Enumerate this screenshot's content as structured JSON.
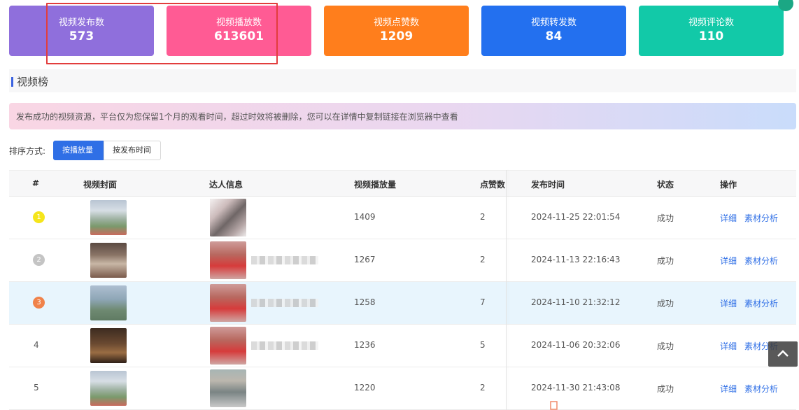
{
  "stats": [
    {
      "label": "视频发布数",
      "value": "573",
      "color": "#8f6fdc"
    },
    {
      "label": "视频播放数",
      "value": "613601",
      "color": "#ff5b94"
    },
    {
      "label": "视频点赞数",
      "value": "1209",
      "color": "#ff7e1c"
    },
    {
      "label": "视频转发数",
      "value": "84",
      "color": "#2370ef"
    },
    {
      "label": "视频评论数",
      "value": "110",
      "color": "#12c9a8"
    }
  ],
  "section": {
    "title": "视频榜"
  },
  "notice": {
    "text": "发布成功的视频资源，平台仅为您保留1个月的观看时间，超过时效将被删除，您可以在详情中复制链接在浏览器中查看"
  },
  "sort": {
    "label": "排序方式:",
    "options": [
      "按播放量",
      "按发布时间"
    ],
    "active": "按播放量"
  },
  "table": {
    "headers": [
      "#",
      "视频封面",
      "达人信息",
      "视频播放量",
      "点赞数",
      "发布时间",
      "状态",
      "操作"
    ],
    "rows": [
      {
        "rank": "1",
        "plays": "1409",
        "likes": "2",
        "time": "2024-11-25 22:01:54",
        "status": "成功",
        "actions": [
          "详细",
          "素材分析"
        ]
      },
      {
        "rank": "2",
        "plays": "1267",
        "likes": "2",
        "time": "2024-11-13 22:16:43",
        "status": "成功",
        "actions": [
          "详细",
          "素材分析"
        ]
      },
      {
        "rank": "3",
        "plays": "1258",
        "likes": "7",
        "time": "2024-11-10 21:32:12",
        "status": "成功",
        "actions": [
          "详细",
          "素材分析"
        ]
      },
      {
        "rank": "4",
        "plays": "1236",
        "likes": "5",
        "time": "2024-11-06 20:32:06",
        "status": "成功",
        "actions": [
          "详细",
          "素材分析"
        ]
      },
      {
        "rank": "5",
        "plays": "1220",
        "likes": "2",
        "time": "2024-11-30 21:43:08",
        "status": "成功",
        "actions": [
          "详细",
          "素材分析"
        ]
      }
    ]
  },
  "rank_colors": [
    "#f5e51b",
    "#c4c4c4",
    "#f0824a"
  ]
}
